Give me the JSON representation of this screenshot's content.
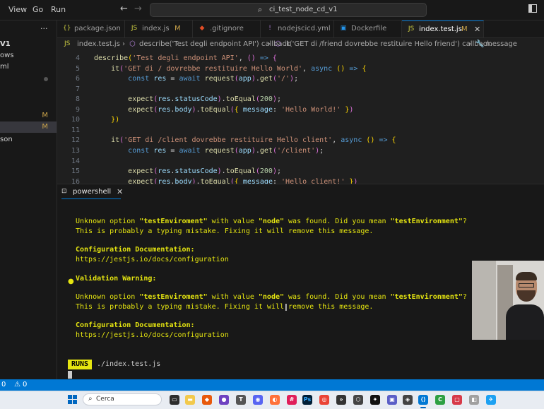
{
  "titlebar": {
    "menu": [
      "View",
      "Go",
      "Run"
    ],
    "back_icon": "arrow-left-icon",
    "forward_icon": "arrow-right-icon",
    "search_value": "ci_test_node_cd_v1"
  },
  "sidebar": {
    "more_label": "···",
    "items": [
      {
        "label": "V1",
        "badge": ""
      },
      {
        "label": "ows",
        "badge": ""
      },
      {
        "label": "ml",
        "badge": ""
      },
      {
        "label": "",
        "badge": "M"
      },
      {
        "label": "",
        "badge": "M"
      },
      {
        "label": "son",
        "badge": ""
      }
    ]
  },
  "tabs": [
    {
      "label": "package.json",
      "icon": "json-icon",
      "modified": "",
      "color": "#cbcb41"
    },
    {
      "label": "index.js",
      "icon": "js-icon",
      "modified": "M",
      "color": "#cbcb41"
    },
    {
      "label": ".gitignore",
      "icon": "git-icon",
      "modified": "",
      "color": "#e44d26"
    },
    {
      "label": "nodejscicd.yml",
      "icon": "yaml-icon",
      "modified": "",
      "color": "#a074c4"
    },
    {
      "label": "Dockerfile",
      "icon": "docker-icon",
      "modified": "",
      "color": "#2496ed"
    },
    {
      "label": "index.test.js",
      "icon": "js-icon",
      "modified": "M",
      "color": "#cbcb41"
    }
  ],
  "breadcrumb": {
    "file": "index.test.js",
    "c1": "describe('Test degli endpoint API') callback",
    "c2": "it('GET di /friend dovrebbe restituire Hello friend') callback",
    "c3": "message"
  },
  "editor": {
    "line_numbers": [
      "4",
      "5",
      "6",
      "7",
      "8",
      "9",
      "10",
      "11",
      "12",
      "13",
      "14",
      "15",
      "16"
    ]
  },
  "terminal": {
    "tab_label": "powershell",
    "warn1_a": "Unknown option ",
    "warn1_b": "\"testEnviroment\"",
    "warn1_c": " with value ",
    "warn1_d": "\"node\"",
    "warn1_e": " was found. Did you mean ",
    "warn1_f": "\"testEnvironment\"",
    "warn1_g": "?",
    "typo_line": "This is probably a typing mistake. Fixing it will remove this message.",
    "config_doc": "Configuration Documentation:",
    "config_url": "https://jestjs.io/docs/configuration",
    "bullet": "●",
    "validation_warning": "Validation Warning:",
    "runs_badge": "RUNS",
    "runs_file": "./index.test.js"
  },
  "statusbar": {
    "errors": "0",
    "warnings": "0"
  },
  "taskbar": {
    "search_label": "Cerca"
  }
}
